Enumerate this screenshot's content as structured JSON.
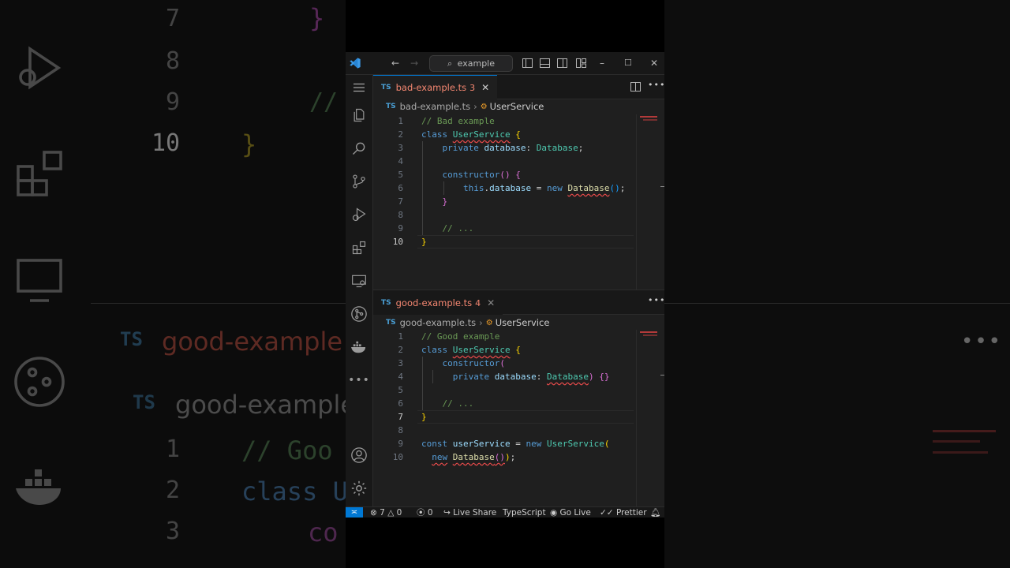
{
  "background": {
    "left_lines": [
      {
        "num": "7",
        "code": "}"
      },
      {
        "num": "8",
        "code": ""
      },
      {
        "num": "9",
        "code": "//"
      },
      {
        "num": "10",
        "code": "}"
      }
    ],
    "tab_name": "good-example",
    "breadcrumb": "good-example",
    "lower_lines": [
      {
        "num": "1",
        "code": "// Goo"
      },
      {
        "num": "2",
        "code": "class U"
      },
      {
        "num": "3",
        "code": "co"
      }
    ]
  },
  "window": {
    "search_placeholder": "example",
    "activity_icons": [
      "explorer-icon",
      "search-icon",
      "source-control-icon",
      "run-debug-icon",
      "extensions-icon",
      "remote-explorer-icon",
      "git-graph-icon",
      "docker-icon",
      "more-icon"
    ],
    "bottom_icons": [
      "accounts-icon",
      "settings-icon"
    ]
  },
  "editor_top": {
    "tab_label": "bad-example.ts",
    "tab_badge": "TS",
    "problem_count": "3",
    "close_glyph": "✕",
    "breadcrumb_file": "bad-example.ts",
    "breadcrumb_symbol": "UserService",
    "line_numbers": [
      "1",
      "2",
      "3",
      "4",
      "5",
      "6",
      "7",
      "8",
      "9",
      "10"
    ]
  },
  "editor_bottom": {
    "tab_label": "good-example.ts",
    "tab_badge": "TS",
    "problem_count": "4",
    "close_glyph": "✕",
    "breadcrumb_file": "good-example.ts",
    "breadcrumb_symbol": "UserService",
    "line_numbers": [
      "1",
      "2",
      "3",
      "4",
      "5",
      "6",
      "7",
      "8",
      "9",
      "10"
    ]
  },
  "code": {
    "bad_comment": "// Bad example",
    "good_comment": "// Good example",
    "kw_class": "class",
    "class_name": "UserService",
    "kw_private": "private",
    "prop": "database",
    "type": "Database",
    "kw_constructor": "constructor",
    "kw_this": "this",
    "kw_new": "new",
    "kw_const": "const",
    "var_name": "userService",
    "ellipsis_comment": "// ..."
  },
  "status": {
    "errors": "7",
    "warnings": "0",
    "ports": "0",
    "live_share": "Live Share",
    "language": "TypeScript",
    "go_live": "Go Live",
    "prettier": "Prettier"
  }
}
